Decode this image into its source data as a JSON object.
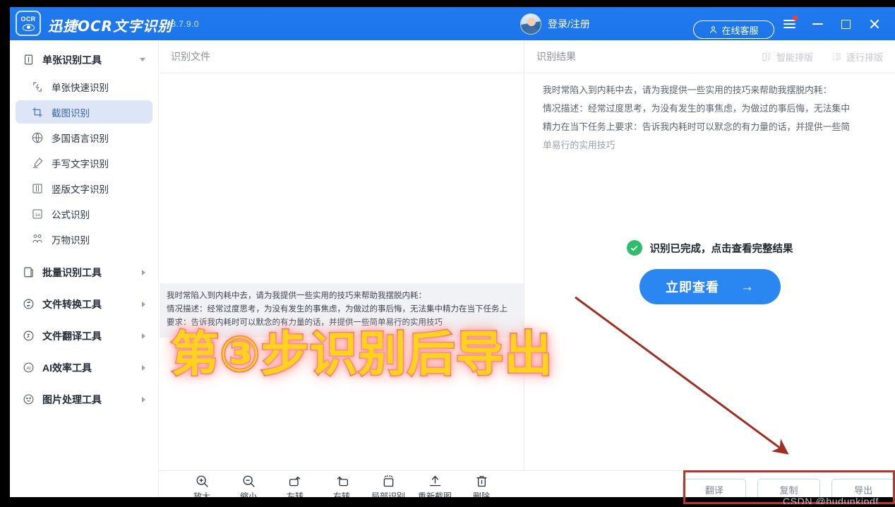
{
  "window": {
    "brand": "迅捷OCR文字识别",
    "version": "v8.7.9.0",
    "logo_text": "OCR",
    "account_label": "登录/注册",
    "service_label": "在线客服"
  },
  "sidebar": {
    "groups": [
      {
        "label": "单张识别工具",
        "icon": "single-doc-icon",
        "expanded": true,
        "items": [
          {
            "label": "单张快速识别",
            "icon": "quick-scan-icon",
            "selected": false
          },
          {
            "label": "截图识别",
            "icon": "crop-icon",
            "selected": true
          },
          {
            "label": "多国语言识别",
            "icon": "globe-icon",
            "selected": false
          },
          {
            "label": "手写文字识别",
            "icon": "pen-icon",
            "selected": false
          },
          {
            "label": "竖版文字识别",
            "icon": "columns-icon",
            "selected": false
          },
          {
            "label": "公式识别",
            "icon": "formula-icon",
            "selected": false
          },
          {
            "label": "万物识别",
            "icon": "objects-icon",
            "selected": false
          }
        ]
      },
      {
        "label": "批量识别工具",
        "icon": "batch-doc-icon",
        "expanded": false,
        "items": []
      },
      {
        "label": "文件转换工具",
        "icon": "convert-icon",
        "expanded": false,
        "items": []
      },
      {
        "label": "文件翻译工具",
        "icon": "translate-icon",
        "expanded": false,
        "items": []
      },
      {
        "label": "AI效率工具",
        "icon": "ai-icon",
        "expanded": false,
        "items": []
      },
      {
        "label": "图片处理工具",
        "icon": "image-edit-icon",
        "expanded": false,
        "items": []
      }
    ]
  },
  "left_panel": {
    "title": "识别文件",
    "document_lines": [
      "我时常陷入到内耗中去，请为我提供一些实用的技巧来帮助我摆脱内耗：",
      "情况描述：经常过度思考，为没有发生的事焦虑，为做过的事后悔，无法集中精力在当下任务上",
      "要求：告诉我内耗时可以默念的有力量的话，并提供一些简单易行的实用技巧"
    ]
  },
  "right_panel": {
    "title": "识别结果",
    "layout_options": [
      {
        "label": "智能排版",
        "icon": "smart-layout-icon"
      },
      {
        "label": "逐行排版",
        "icon": "line-layout-icon"
      }
    ],
    "result_lines": [
      "我时常陷入到内耗中去，请为我提供一些实用的技巧来帮助我摆脱内耗：",
      "情况描述：经常过度思考，为没有发生的事焦虑，为做过的事后悔，无法集中",
      "精力在当下任务上要求：告诉我内耗时可以默念的有力量的话，并提供一些简",
      "单易行的实用技巧"
    ],
    "status_text": "识别已完成，点击查看完整结果",
    "cta_label": "立即查看",
    "cta_arrow": "→"
  },
  "toolbar": {
    "tools": [
      {
        "label": "放大",
        "icon": "zoom-in-icon"
      },
      {
        "label": "缩小",
        "icon": "zoom-out-icon"
      },
      {
        "label": "左转",
        "icon": "rotate-left-icon"
      },
      {
        "label": "右转",
        "icon": "rotate-right-icon"
      },
      {
        "label": "局部识别",
        "icon": "partial-recognize-icon"
      },
      {
        "label": "重新截图",
        "icon": "rescreenshot-icon"
      },
      {
        "label": "删除",
        "icon": "trash-icon"
      }
    ],
    "actions": [
      {
        "label": "翻译",
        "name": "translate-button"
      },
      {
        "label": "复制",
        "name": "copy-button"
      },
      {
        "label": "导出",
        "name": "export-button"
      }
    ]
  },
  "annotation": {
    "text": "第③步识别后导出",
    "fill_color": "#ffd21e",
    "stroke_color": "#e8340c",
    "glow_color": "#ff8a8a",
    "arrow_color": "#9e2f24",
    "highlight_color": "#b03a2e"
  },
  "watermark": {
    "text": "CSDN @hudunkjpdf"
  },
  "theme": {
    "accent": "#1b78ed",
    "cta": "#2a86f0",
    "success": "#2fbd6d",
    "selected_bg": "#dde6f7"
  }
}
